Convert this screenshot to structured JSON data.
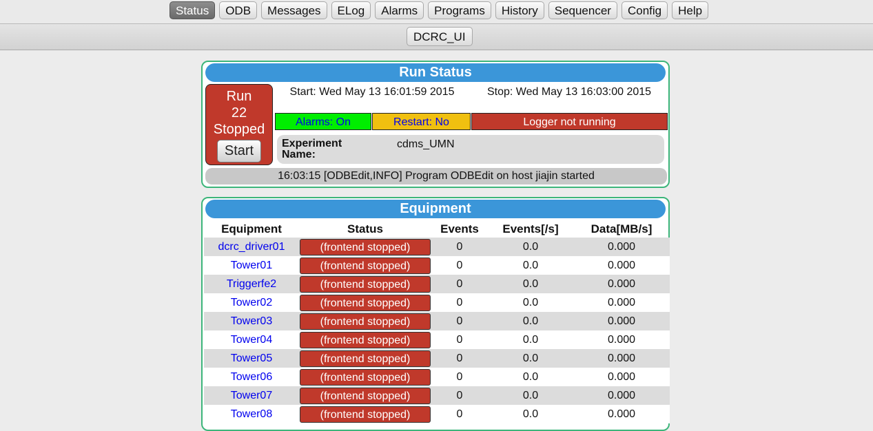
{
  "nav": {
    "items": [
      "Status",
      "ODB",
      "Messages",
      "ELog",
      "Alarms",
      "Programs",
      "History",
      "Sequencer",
      "Config",
      "Help"
    ],
    "active": "Status"
  },
  "subnav": {
    "button_label": "DCRC_UI"
  },
  "colors": {
    "accent_blue": "#3b96d9",
    "panel_border": "#3cb57a",
    "stopped_red": "#c0392b",
    "alarm_green": "#00ee00",
    "restart_yellow": "#f0c010",
    "link_blue": "#0000ee"
  },
  "run_status": {
    "title": "Run Status",
    "run_word": "Run",
    "run_number": "22",
    "run_state": "Stopped",
    "start_button": "Start",
    "start_time": "Start: Wed May 13 16:01:59 2015",
    "stop_time": "Stop: Wed May 13 16:03:00 2015",
    "alarms": "Alarms: On",
    "restart": "Restart: No",
    "logger": "Logger not running",
    "experiment_label": "Experiment Name:",
    "experiment_value": "cdms_UMN",
    "message": "16:03:15 [ODBEdit,INFO] Program ODBEdit on host jiajin started"
  },
  "equipment": {
    "title": "Equipment",
    "columns": [
      "Equipment",
      "Status",
      "Events",
      "Events[/s]",
      "Data[MB/s]"
    ],
    "rows": [
      {
        "name": "dcrc_driver01",
        "status": "(frontend stopped)",
        "events": "0",
        "rate": "0.0",
        "data": "0.000"
      },
      {
        "name": "Tower01",
        "status": "(frontend stopped)",
        "events": "0",
        "rate": "0.0",
        "data": "0.000"
      },
      {
        "name": "Triggerfe2",
        "status": "(frontend stopped)",
        "events": "0",
        "rate": "0.0",
        "data": "0.000"
      },
      {
        "name": "Tower02",
        "status": "(frontend stopped)",
        "events": "0",
        "rate": "0.0",
        "data": "0.000"
      },
      {
        "name": "Tower03",
        "status": "(frontend stopped)",
        "events": "0",
        "rate": "0.0",
        "data": "0.000"
      },
      {
        "name": "Tower04",
        "status": "(frontend stopped)",
        "events": "0",
        "rate": "0.0",
        "data": "0.000"
      },
      {
        "name": "Tower05",
        "status": "(frontend stopped)",
        "events": "0",
        "rate": "0.0",
        "data": "0.000"
      },
      {
        "name": "Tower06",
        "status": "(frontend stopped)",
        "events": "0",
        "rate": "0.0",
        "data": "0.000"
      },
      {
        "name": "Tower07",
        "status": "(frontend stopped)",
        "events": "0",
        "rate": "0.0",
        "data": "0.000"
      },
      {
        "name": "Tower08",
        "status": "(frontend stopped)",
        "events": "0",
        "rate": "0.0",
        "data": "0.000"
      }
    ]
  }
}
